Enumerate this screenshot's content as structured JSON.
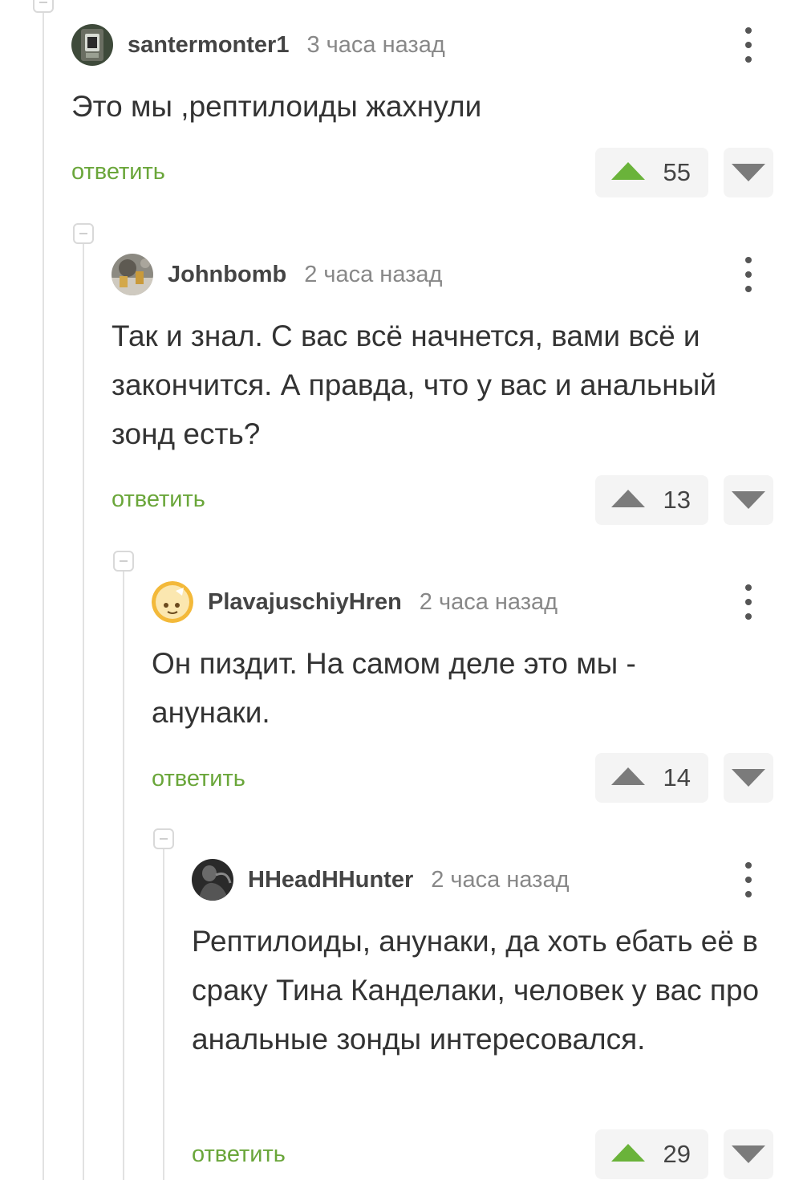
{
  "comments": [
    {
      "username": "santermonter1",
      "time": "3 часа назад",
      "text": "Это мы ,рептилоиды жахнули",
      "reply_label": "ответить",
      "score": "55",
      "upvoted": true,
      "avatar_icon": "avatar-coffee-machine"
    },
    {
      "username": "Johnbomb",
      "time": "2 часа назад",
      "text": "Так и знал. С вас всё начнется, вами всё и закончится. А правда, что у вас и анальный зонд есть?",
      "reply_label": "ответить",
      "score": "13",
      "upvoted": false,
      "avatar_icon": "avatar-beer-table"
    },
    {
      "username": "PlavajuschiyHren",
      "time": "2 часа назад",
      "text": "Он пиздит. На самом деле это мы - анунаки.",
      "reply_label": "ответить",
      "score": "14",
      "upvoted": false,
      "avatar_icon": "avatar-cartoon-face"
    },
    {
      "username": "HHeadHHunter",
      "time": "2 часа назад",
      "text": "Рептилоиды, анунаки, да хоть ебать её в сраку Тина Канделаки, человек у вас про анальные зонды интересовался.",
      "reply_label": "ответить",
      "score": "29",
      "upvoted": true,
      "avatar_icon": "avatar-dark-figure"
    }
  ],
  "colors": {
    "reply_link": "#6aa63a",
    "upvote_active": "#6ab33a",
    "vote_inactive": "#7b7b7b"
  }
}
